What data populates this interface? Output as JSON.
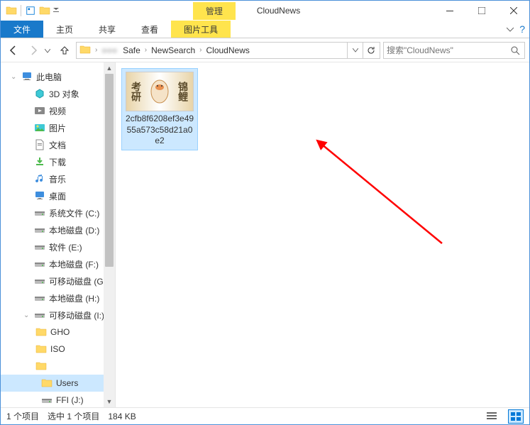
{
  "titlebar": {
    "contextual_label": "管理",
    "window_title": "CloudNews"
  },
  "tabs": {
    "file": "文件",
    "home": "主页",
    "share": "共享",
    "view": "查看",
    "picture_tools": "图片工具"
  },
  "breadcrumb": {
    "segments": [
      "Safe",
      "NewSearch",
      "CloudNews"
    ]
  },
  "search": {
    "placeholder": "搜索\"CloudNews\""
  },
  "navpane": {
    "this_pc": "此电脑",
    "items": [
      {
        "label": "3D 对象",
        "icon": "3d"
      },
      {
        "label": "视频",
        "icon": "video"
      },
      {
        "label": "图片",
        "icon": "pictures"
      },
      {
        "label": "文档",
        "icon": "documents"
      },
      {
        "label": "下载",
        "icon": "downloads"
      },
      {
        "label": "音乐",
        "icon": "music"
      },
      {
        "label": "桌面",
        "icon": "desktop"
      },
      {
        "label": "系统文件 (C:)",
        "icon": "drive"
      },
      {
        "label": "本地磁盘 (D:)",
        "icon": "drive"
      },
      {
        "label": "软件 (E:)",
        "icon": "drive"
      },
      {
        "label": "本地磁盘 (F:)",
        "icon": "drive"
      },
      {
        "label": "可移动磁盘 (G:)",
        "icon": "drive"
      },
      {
        "label": "本地磁盘 (H:)",
        "icon": "drive"
      },
      {
        "label": "可移动磁盘 (I:)",
        "icon": "drive",
        "expanded": true
      }
    ],
    "sub_items": [
      {
        "label": "GHO",
        "icon": "folder"
      },
      {
        "label": "ISO",
        "icon": "folder"
      },
      {
        "label": "",
        "icon": "folder",
        "blurred": true
      }
    ],
    "nested": [
      {
        "label": "Users",
        "icon": "folder",
        "selected": true
      },
      {
        "label": "FFI (J:)",
        "icon": "drive"
      }
    ]
  },
  "content": {
    "file_name": "2cfb8f6208ef3e4955a573c58d21a0e2",
    "thumb_text_left": "考研",
    "thumb_text_right": "锦鲤"
  },
  "statusbar": {
    "item_count": "1 个项目",
    "selected": "选中 1 个项目",
    "size": "184 KB"
  }
}
